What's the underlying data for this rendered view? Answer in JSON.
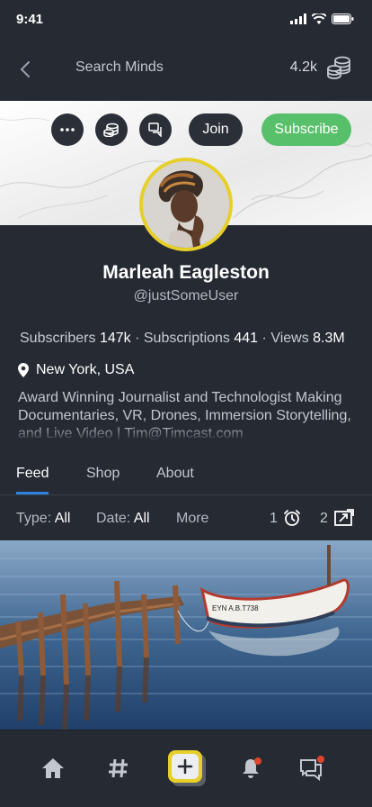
{
  "status": {
    "time": "9:41"
  },
  "topbar": {
    "search_label": "Search Minds",
    "token_count": "4.2k"
  },
  "actions": {
    "join_label": "Join",
    "subscribe_label": "Subscribe"
  },
  "profile": {
    "name": "Marleah Eagleston",
    "username": "@justSomeUser",
    "stats": {
      "subscribers_label": "Subscribers",
      "subscribers_value": "147k",
      "subscriptions_label": "Subscriptions",
      "subscriptions_value": "441",
      "views_label": "Views",
      "views_value": "8.3M",
      "separator": "·"
    },
    "location": "New York, USA",
    "bio": "Award Winning Journalist and Technologist Making Documentaries, VR, Drones, Immersion Storytelling, and Live Video | Tim@Timcast.com"
  },
  "tabs": [
    {
      "label": "Feed"
    },
    {
      "label": "Shop"
    },
    {
      "label": "About"
    }
  ],
  "filters": {
    "type_label": "Type:",
    "type_value": "All",
    "date_label": "Date:",
    "date_value": "All",
    "more_label": "More",
    "scheduled_count": "1",
    "boosted_count": "2"
  },
  "feed": {
    "image_subject": "wooden pier and boat",
    "boat_text": "EYN A.B.T738"
  },
  "colors": {
    "background": "#252a33",
    "accent_blue": "#2f7fdc",
    "subscribe_green": "#58c06a",
    "avatar_ring": "#e7cf2a",
    "notification_dot": "#e0442d"
  },
  "icons": {
    "back": "chevron-left-icon",
    "tokens": "coins-stack-icon",
    "more": "more-dots-icon",
    "wallet": "coins-icon",
    "chat": "chat-icon",
    "location": "location-pin-icon",
    "scheduled": "alarm-clock-icon",
    "boosted": "boost-icon",
    "home": "home-icon",
    "discovery": "hashtag-icon",
    "compose": "plus-icon",
    "notifications": "bell-icon",
    "messenger": "messenger-icon"
  }
}
